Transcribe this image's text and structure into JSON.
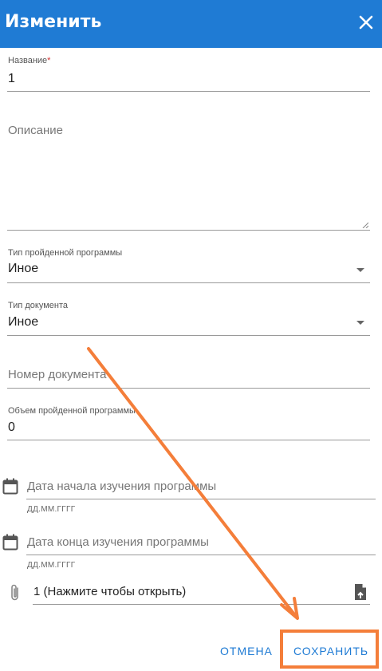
{
  "header": {
    "title": "Изменить"
  },
  "form": {
    "name_label": "Название",
    "name_required": "*",
    "name_value": "1",
    "description_placeholder": "Описание",
    "program_type_label": "Тип пройденной программы",
    "program_type_value": "Иное",
    "doc_type_label": "Тип документа",
    "doc_type_value": "Иное",
    "doc_number_placeholder": "Номер документа",
    "volume_label": "Объем пройденной программы",
    "volume_value": "0",
    "start_date_placeholder": "Дата начала изучения программы",
    "start_date_hint": "ДД.ММ.ГГГГ",
    "end_date_placeholder": "Дата конца изучения программы",
    "end_date_hint": "ДД.ММ.ГГГГ",
    "file_value": "1 (Нажмите чтобы открыть)"
  },
  "actions": {
    "cancel_label": "ОТМЕНА",
    "save_label": "СОХРАНИТЬ"
  },
  "colors": {
    "primary": "#1f7bd4",
    "annotation": "#f47e3a",
    "required": "#d32f2f"
  },
  "icons": [
    "close-icon",
    "calendar-icon",
    "paperclip-icon",
    "file-upload-icon",
    "dropdown-arrow-icon"
  ]
}
